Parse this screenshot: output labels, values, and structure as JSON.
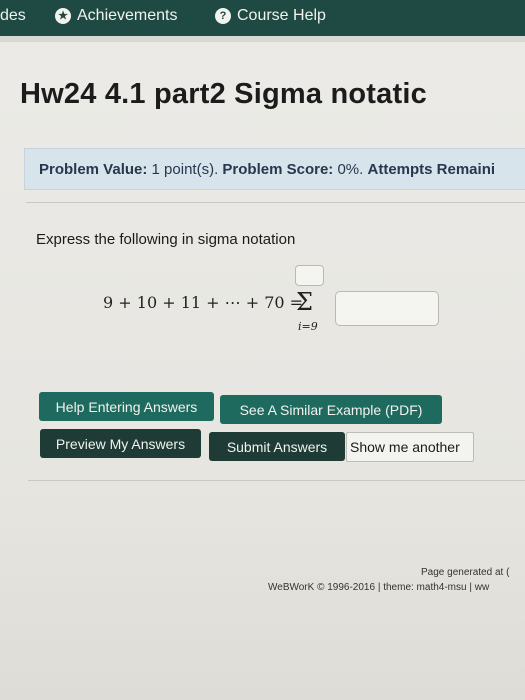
{
  "nav": {
    "partial_item": "des",
    "achievements": "Achievements",
    "course_help": "Course Help"
  },
  "page_title": "Hw24 4.1 part2 Sigma notatic",
  "info_bar": {
    "value_label": "Problem Value:",
    "value": "1 point(s).",
    "score_label": "Problem Score:",
    "score": "0%.",
    "attempts_label": "Attempts Remaini"
  },
  "problem": {
    "prompt": "Express the following in sigma notation",
    "expression": "9 + 10 + 11 + ⋯ + 70 =",
    "sigma_symbol": "Σ",
    "lower_limit": "i=9"
  },
  "buttons": {
    "help_entering": "Help Entering Answers",
    "similar_example": "See A Similar Example (PDF)",
    "preview": "Preview My Answers",
    "submit": "Submit Answers",
    "show_another": "Show me another"
  },
  "footer": {
    "generated": "Page generated at (",
    "copyright": "WeBWorK © 1996-2016 | theme: math4-msu | ww"
  },
  "colors": {
    "header_bg": "#1e4a43",
    "teal_button": "#1f6a5f",
    "dark_button": "#1f3b36",
    "info_bg": "#d7e4ec"
  }
}
